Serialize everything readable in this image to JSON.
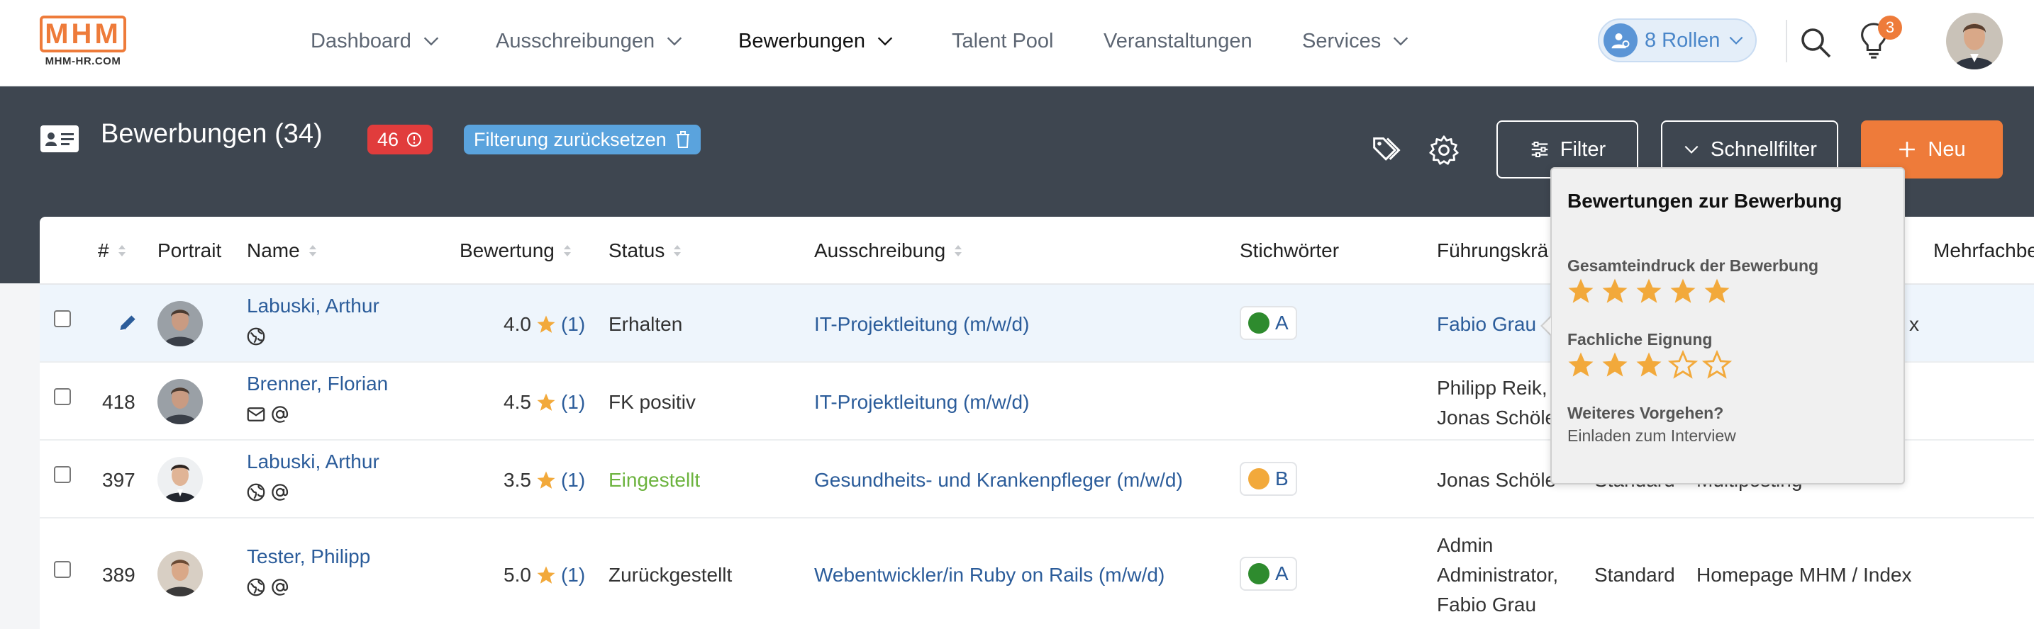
{
  "nav": {
    "logo_letters": "MHM",
    "logo_sub": "MHM-HR.COM",
    "items": [
      {
        "label": "Dashboard"
      },
      {
        "label": "Ausschreibungen"
      },
      {
        "label": "Bewerbungen"
      },
      {
        "label": "Talent Pool"
      },
      {
        "label": "Veranstaltungen"
      },
      {
        "label": "Services"
      }
    ],
    "active_item": "Bewerbungen",
    "roles_label": "8 Rollen",
    "notification_count": "3"
  },
  "header": {
    "title": "Bewerbungen (34)",
    "badge_count": "46",
    "reset_label": "Filterung zurücksetzen",
    "filter_label": "Filter",
    "quickfilter_label": "Schnellfilter",
    "new_label": "Neu"
  },
  "table": {
    "columns": [
      "#",
      "Portrait",
      "Name",
      "Bewertung",
      "Status",
      "Ausschreibung",
      "Stichwörter",
      "Führungskrä",
      "Mehrfachbe"
    ],
    "rows": [
      {
        "num": "",
        "name": "Labuski, Arthur",
        "rating": "4.0",
        "rating_count": "(1)",
        "status": "Erhalten",
        "job": "IT-Projektleitung (m/w/d)",
        "tag": "A",
        "tag_color": "#2e8b2e",
        "lead_lines": [
          "Fabio Grau"
        ],
        "col_extra1": "",
        "col_extra2": "x"
      },
      {
        "num": "418",
        "name": "Brenner, Florian",
        "rating": "4.5",
        "rating_count": "(1)",
        "status": "FK positiv",
        "job": "IT-Projektleitung (m/w/d)",
        "tag": "",
        "tag_color": "",
        "lead_lines": [
          "Philipp Reik,",
          "Jonas Schöle"
        ],
        "col_extra1": "",
        "col_extra2": ""
      },
      {
        "num": "397",
        "name": "Labuski, Arthur",
        "rating": "3.5",
        "rating_count": "(1)",
        "status": "Eingestellt",
        "job": "Gesundheits- und Krankenpfleger (m/w/d)",
        "tag": "B",
        "tag_color": "#f2a93b",
        "lead_lines": [
          "Jonas Schöle"
        ],
        "col_extra1": "Standard",
        "col_extra2": "Multiposting"
      },
      {
        "num": "389",
        "name": "Tester, Philipp",
        "rating": "5.0",
        "rating_count": "(1)",
        "status": "Zurückgestellt",
        "job": "Webentwickler/in Ruby on Rails (m/w/d)",
        "tag": "A",
        "tag_color": "#2e8b2e",
        "lead_lines": [
          "Admin",
          "Administrator,",
          "Fabio Grau"
        ],
        "col_extra1": "Standard",
        "col_extra2": "Homepage MHM / Index"
      }
    ]
  },
  "popover": {
    "title": "Bewertungen zur Bewerbung",
    "criteria": [
      {
        "label": "Gesamteindruck der Bewerbung",
        "stars": 5
      },
      {
        "label": "Fachliche Eignung",
        "stars": 3
      }
    ],
    "next_label": "Weiteres Vorgehen?",
    "next_value": "Einladen zum Interview"
  },
  "colors": {
    "accent_orange": "#ee7b3a",
    "dark_band": "#3e4650",
    "link_blue": "#2b5c9a",
    "star": "#f2a93b",
    "badge_red": "#e13c3c",
    "reset_blue": "#5aa3dd",
    "status_green": "#6cb33e"
  }
}
